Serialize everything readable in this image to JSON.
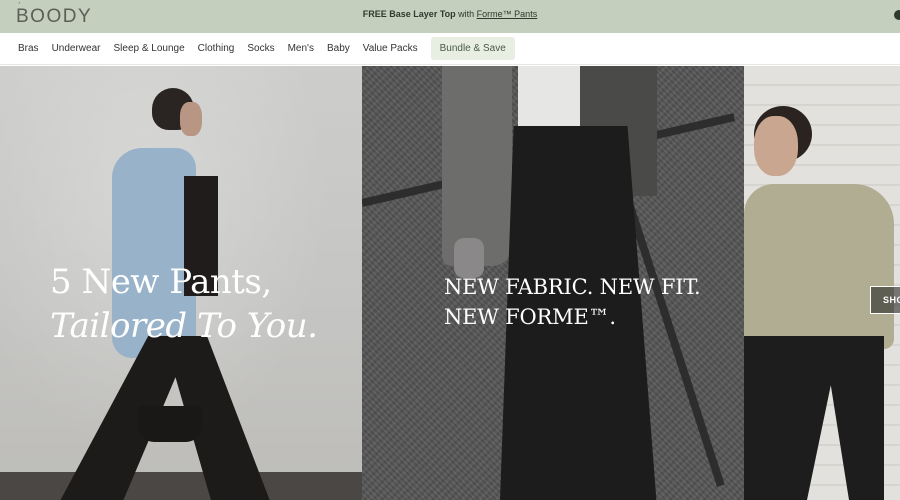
{
  "header": {
    "logo": "BOODY",
    "promo": {
      "bold": "FREE Base Layer Top",
      "middle": " with ",
      "link": "Forme™ Pants"
    }
  },
  "nav": {
    "items": [
      {
        "label": "Bras"
      },
      {
        "label": "Underwear"
      },
      {
        "label": "Sleep & Lounge"
      },
      {
        "label": "Clothing"
      },
      {
        "label": "Socks"
      },
      {
        "label": "Men's"
      },
      {
        "label": "Baby"
      },
      {
        "label": "Value Packs"
      }
    ],
    "bundle": "Bundle & Save"
  },
  "hero": {
    "panel1": {
      "line1": "5 New Pants,",
      "line2": "Tailored To You."
    },
    "panel2": {
      "line1": "NEW FABRIC. NEW FIT.",
      "line2": "NEW FORME™."
    },
    "panel3": {
      "button": "SHO"
    }
  },
  "colors": {
    "topbar": "#c5cfbd",
    "bundle_bg": "#e9eee3"
  }
}
